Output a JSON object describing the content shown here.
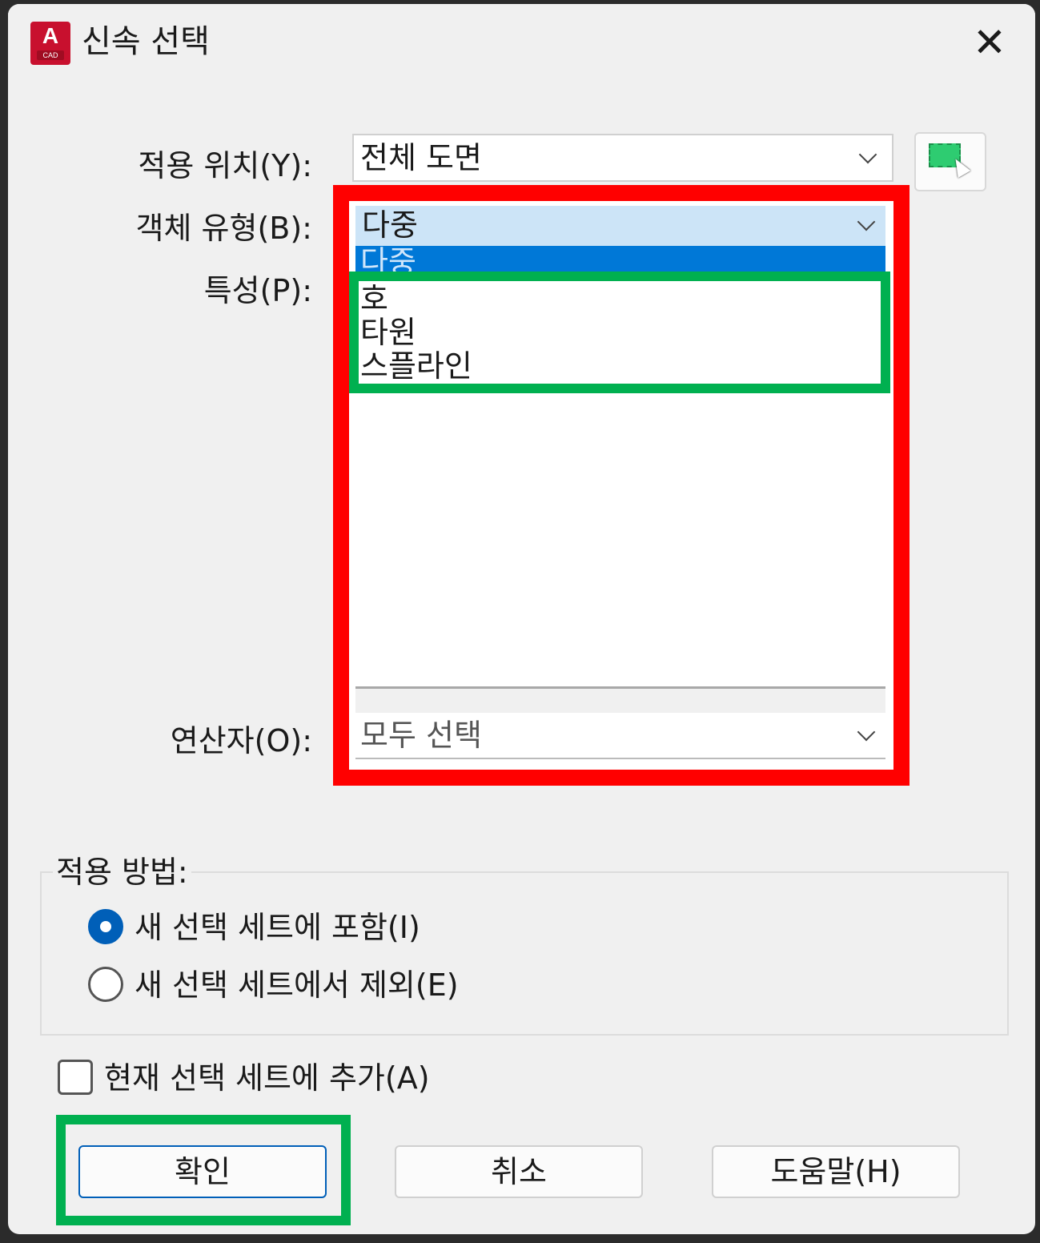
{
  "window": {
    "title": "신속 선택",
    "app_icon": {
      "letter": "A",
      "sub": "CAD",
      "color": "#c8102e"
    },
    "close_icon": "✕"
  },
  "form": {
    "apply_to": {
      "label": "적용 위치(Y):",
      "value": "전체 도면"
    },
    "object_type": {
      "label": "객체 유형(B):",
      "value": "다중"
    },
    "properties": {
      "label": "특성(P):"
    },
    "operator": {
      "label": "연산자(O):",
      "value": "모두 선택"
    }
  },
  "dropdown": {
    "items": [
      "다중",
      "호",
      "타원",
      "스플라인"
    ],
    "selected_index": 0,
    "highlight_color": "#0078d7"
  },
  "annotations": {
    "red_box_color": "#ff0000",
    "green_box_color": "#00b050"
  },
  "how_to_apply": {
    "legend": "적용 방법:",
    "options": [
      {
        "label": "새 선택 세트에 포함(I)",
        "checked": true
      },
      {
        "label": "새 선택 세트에서 제외(E)",
        "checked": false
      }
    ]
  },
  "append": {
    "label": "현재 선택 세트에 추가(A)",
    "checked": false
  },
  "buttons": {
    "ok": "확인",
    "cancel": "취소",
    "help": "도움말(H)"
  }
}
